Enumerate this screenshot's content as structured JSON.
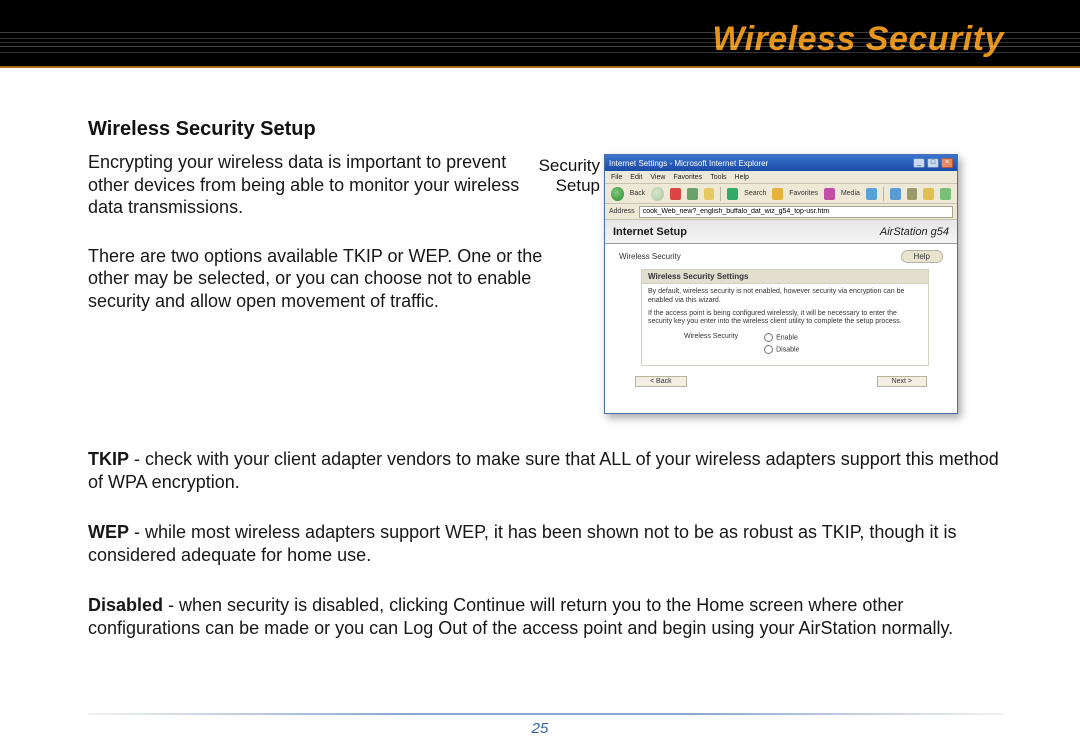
{
  "header": {
    "title": "Wireless Security"
  },
  "section": {
    "heading": "Wireless Security Setup",
    "intro1": "Encrypting your wireless data is important to prevent other devices from being able to monitor your wireless data transmissions.",
    "intro2": "There are two options available TKIP or WEP. One or the other may be selected, or you can choose not to enable security and allow open movement of traffic.",
    "tkip_term": "TKIP",
    "tkip_text": " - check with your client adapter vendors to make sure that ALL of your wireless adapters support this method of WPA encryption.",
    "wep_term": "WEP",
    "wep_text": " - while most wireless adapters support WEP, it has been shown not to be as robust as TKIP, though it is considered adequate for home use.",
    "disabled_term": "Disabled",
    "disabled_text": " - when security is disabled, clicking Continue will return you to the Home screen where other configurations can be made or you can Log Out of the access point and begin using your AirStation normally."
  },
  "screenshot": {
    "caption_line1": "Security",
    "caption_line2": "Setup",
    "window_title": "Internet Settings - Microsoft Internet Explorer",
    "menus": [
      "File",
      "Edit",
      "View",
      "Favorites",
      "Tools",
      "Help"
    ],
    "back_label": "Back",
    "toolbar_search": "Search",
    "toolbar_favorites": "Favorites",
    "toolbar_media": "Media",
    "addr_label": "Address",
    "addr_value": "cook_Web_new?_english_buffalo_dat_wiz_g54_top-usr.htm",
    "page_title": "Internet Setup",
    "brand": "AirStation",
    "brand_model": " g54",
    "sub_title": "Wireless Security",
    "help": "Help",
    "box_title": "Wireless Security Settings",
    "box_p1": "By default, wireless security is not enabled, however security via encryption can be enabled via this wizard.",
    "box_p2": "If the access point is being configured wirelessly, it will be necessary to enter the security key you enter into the wireless client utility to complete the setup process.",
    "radio_label": "Wireless Security",
    "opt_enable": "Enable",
    "opt_disable": "Disable",
    "btn_back": "< Back",
    "btn_next": "Next >"
  },
  "page_number": "25"
}
